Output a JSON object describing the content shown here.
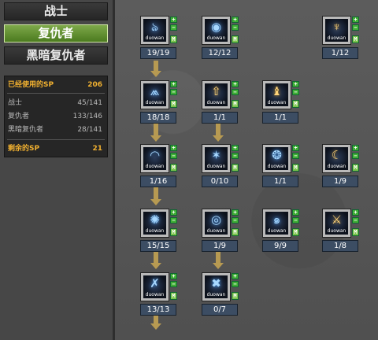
{
  "classes": [
    {
      "label": "战士",
      "active": false
    },
    {
      "label": "复仇者",
      "active": true
    },
    {
      "label": "黑暗复仇者",
      "active": false
    }
  ],
  "sp": {
    "used_label": "已经使用的SP",
    "used_value": "206",
    "rows": [
      {
        "label": "战士",
        "value": "45/141"
      },
      {
        "label": "复仇者",
        "value": "133/146"
      },
      {
        "label": "黑暗复仇者",
        "value": "28/141"
      }
    ],
    "remain_label": "剩余的SP",
    "remain_value": "21"
  },
  "controls": {
    "plus": "+",
    "minus": "−",
    "max": "M"
  },
  "skills": [
    {
      "icon_name": "shadow-strike-icon",
      "glyph": "ঌ",
      "watermark": "duowan",
      "level": "19/19"
    },
    {
      "icon_name": "dark-orb-icon",
      "glyph": "◉",
      "watermark": "duowan",
      "level": "12/12"
    },
    {
      "icon_name": "flame-totem-icon",
      "glyph": "♆",
      "watermark": "duowan",
      "level": "1/12",
      "gold": true
    },
    {
      "icon_name": "rising-wave-icon",
      "glyph": "⩕",
      "watermark": "duowan",
      "level": "18/18"
    },
    {
      "icon_name": "up-arrow-icon",
      "glyph": "⇧",
      "watermark": "duowan",
      "level": "1/1",
      "gold": true
    },
    {
      "icon_name": "golden-statue-icon",
      "glyph": "♝",
      "watermark": "duowan",
      "level": "1/1",
      "gold": true
    },
    {
      "icon_name": "slash-wave-icon",
      "glyph": "◠",
      "watermark": "duowan",
      "level": "1/16"
    },
    {
      "icon_name": "spirit-figure-icon",
      "glyph": "✶",
      "watermark": "duowan",
      "level": "0/10"
    },
    {
      "icon_name": "swirl-claw-icon",
      "glyph": "❂",
      "watermark": "duowan",
      "level": "1/1"
    },
    {
      "icon_name": "crescent-blade-icon",
      "glyph": "☾",
      "watermark": "duowan",
      "level": "1/9",
      "gold": true
    },
    {
      "icon_name": "burst-icon",
      "glyph": "✺",
      "watermark": "duowan",
      "level": "15/15"
    },
    {
      "icon_name": "eye-ring-icon",
      "glyph": "◎",
      "watermark": "duowan",
      "level": "1/9"
    },
    {
      "icon_name": "spiral-icon",
      "glyph": "๑",
      "watermark": "duowan",
      "level": "9/9"
    },
    {
      "icon_name": "scythe-icon",
      "glyph": "⚔",
      "watermark": "duowan",
      "level": "1/8",
      "gold": true
    },
    {
      "icon_name": "cross-slash-icon",
      "glyph": "✗",
      "watermark": "duowan",
      "level": "13/13"
    },
    {
      "icon_name": "x-burst-icon",
      "glyph": "✖",
      "watermark": "duowan",
      "level": "0/7"
    }
  ],
  "colors": {
    "active_class": "#5f8f30",
    "sp_highlight": "#f0b030",
    "plus_button": "#3fae35",
    "level_box": "#3c4d63",
    "arrow": "#b79a52"
  }
}
